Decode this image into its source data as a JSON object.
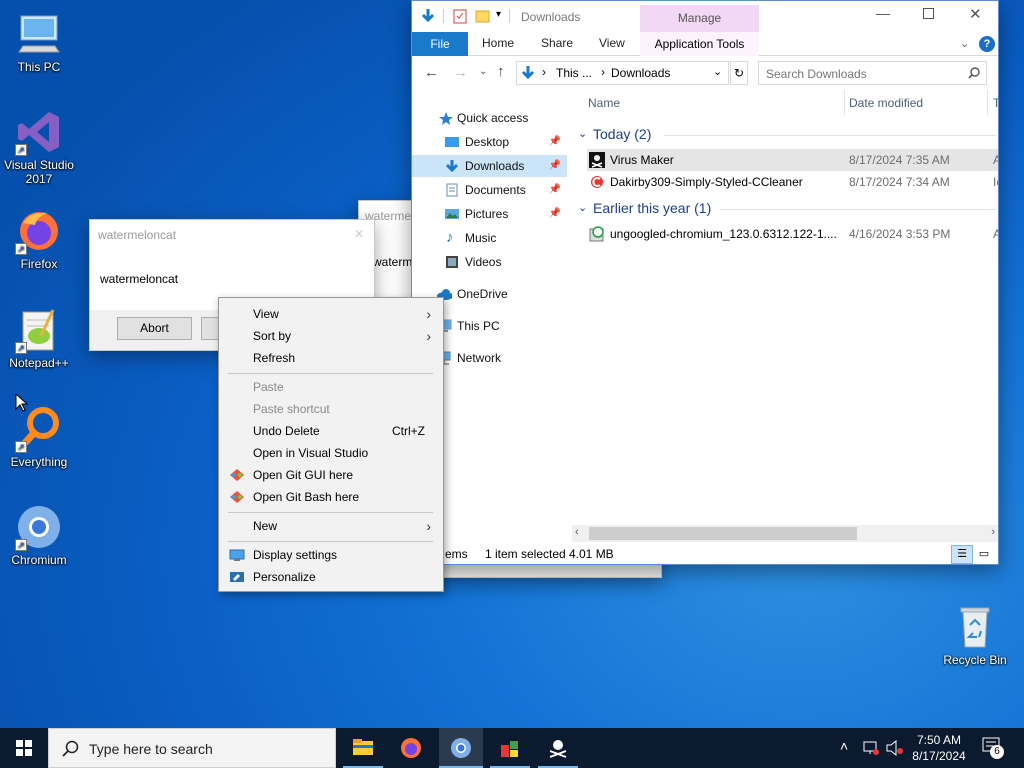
{
  "desktop_icons": [
    {
      "label": "This PC"
    },
    {
      "label": "Visual Studio 2017"
    },
    {
      "label": "Firefox"
    },
    {
      "label": "Notepad++"
    },
    {
      "label": "Everything"
    },
    {
      "label": "Chromium"
    },
    {
      "label": "Recycle Bin"
    }
  ],
  "dialog1": {
    "title": "watermeloncat",
    "message": "watermeloncat",
    "abort_label": "Abort"
  },
  "dialog2": {
    "title": "waterme",
    "message": "waterme"
  },
  "explorer": {
    "title": "Downloads",
    "manage_label": "Manage",
    "tabs": [
      "File",
      "Home",
      "Share",
      "View",
      "Application Tools"
    ],
    "breadcrumb": [
      "This ...",
      "Downloads"
    ],
    "search_placeholder": "Search Downloads",
    "col_name": "Name",
    "col_date": "Date modified",
    "col_extra": "T",
    "nav": [
      {
        "label": "Quick access",
        "pinned": false
      },
      {
        "label": "Desktop",
        "pinned": true
      },
      {
        "label": "Downloads",
        "pinned": true
      },
      {
        "label": "Documents",
        "pinned": true
      },
      {
        "label": "Pictures",
        "pinned": true
      },
      {
        "label": "Music",
        "pinned": false
      },
      {
        "label": "Videos",
        "pinned": false
      },
      {
        "label": "OneDrive",
        "pinned": false
      },
      {
        "label": "This PC",
        "pinned": false
      },
      {
        "label": "Network",
        "pinned": false
      }
    ],
    "groups": [
      {
        "label": "Today (2)",
        "files": [
          {
            "name": "Virus Maker",
            "date": "8/17/2024 7:35 AM",
            "extra": "A"
          },
          {
            "name": "Dakirby309-Simply-Styled-CCleaner",
            "date": "8/17/2024 7:34 AM",
            "extra": "Ic"
          }
        ]
      },
      {
        "label": "Earlier this year (1)",
        "files": [
          {
            "name": "ungoogled-chromium_123.0.6312.122-1....",
            "date": "4/16/2024 3:53 PM",
            "extra": "A"
          }
        ]
      }
    ],
    "status_items": "ems",
    "status_selected": "1 item selected",
    "status_size": "4.01 MB"
  },
  "context_menu": {
    "view": "View",
    "sort_by": "Sort by",
    "refresh": "Refresh",
    "paste": "Paste",
    "paste_shortcut": "Paste shortcut",
    "undo_delete": "Undo Delete",
    "undo_shortcut": "Ctrl+Z",
    "open_vs": "Open in Visual Studio",
    "git_gui": "Open Git GUI here",
    "git_bash": "Open Git Bash here",
    "new": "New",
    "display_settings": "Display settings",
    "personalize": "Personalize"
  },
  "taskbar": {
    "search_placeholder": "Type here to search",
    "time": "7:50 AM",
    "date": "8/17/2024",
    "notification_count": "6"
  },
  "colors": {
    "accent": "#1979ca",
    "manage_tab": "#f2d8f5",
    "taskbar": "#0b1a2e"
  }
}
